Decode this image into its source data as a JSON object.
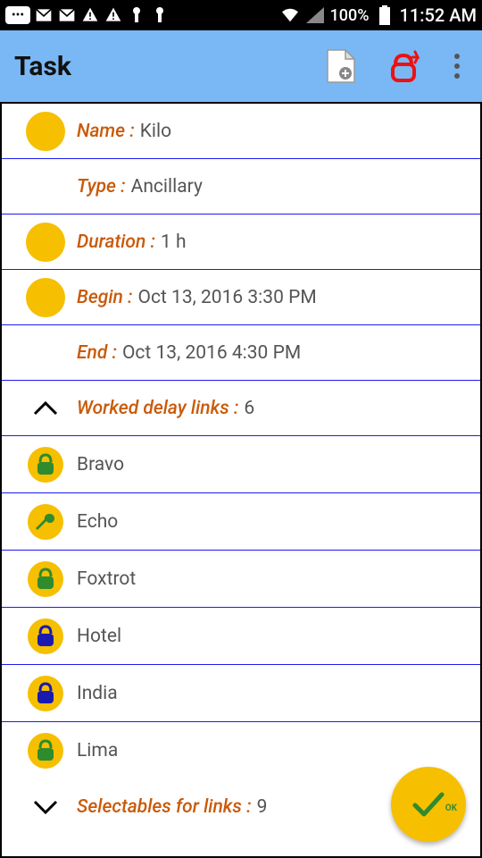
{
  "statusbar": {
    "battery_pct": "100%",
    "time": "11:52 AM"
  },
  "appbar": {
    "title": "Task"
  },
  "fields": {
    "name": {
      "label": "Name :",
      "value": "Kilo"
    },
    "type": {
      "label": "Type :",
      "value": "Ancillary"
    },
    "duration": {
      "label": "Duration :",
      "value": "1 h"
    },
    "begin": {
      "label": "Begin :",
      "value": "Oct 13, 2016 3:30 PM"
    },
    "end": {
      "label": "End :",
      "value": "Oct 13, 2016 4:30 PM"
    }
  },
  "worked": {
    "label": "Worked delay links :",
    "count": "6",
    "items": [
      {
        "name": "Bravo",
        "icon": "lock-green"
      },
      {
        "name": "Echo",
        "icon": "wrench"
      },
      {
        "name": "Foxtrot",
        "icon": "lock-green"
      },
      {
        "name": "Hotel",
        "icon": "lock-blue"
      },
      {
        "name": "India",
        "icon": "lock-blue"
      },
      {
        "name": "Lima",
        "icon": "lock-green"
      }
    ]
  },
  "selectables": {
    "label": "Selectables for links :",
    "count": "9"
  },
  "fab": {
    "ok": "OK"
  }
}
